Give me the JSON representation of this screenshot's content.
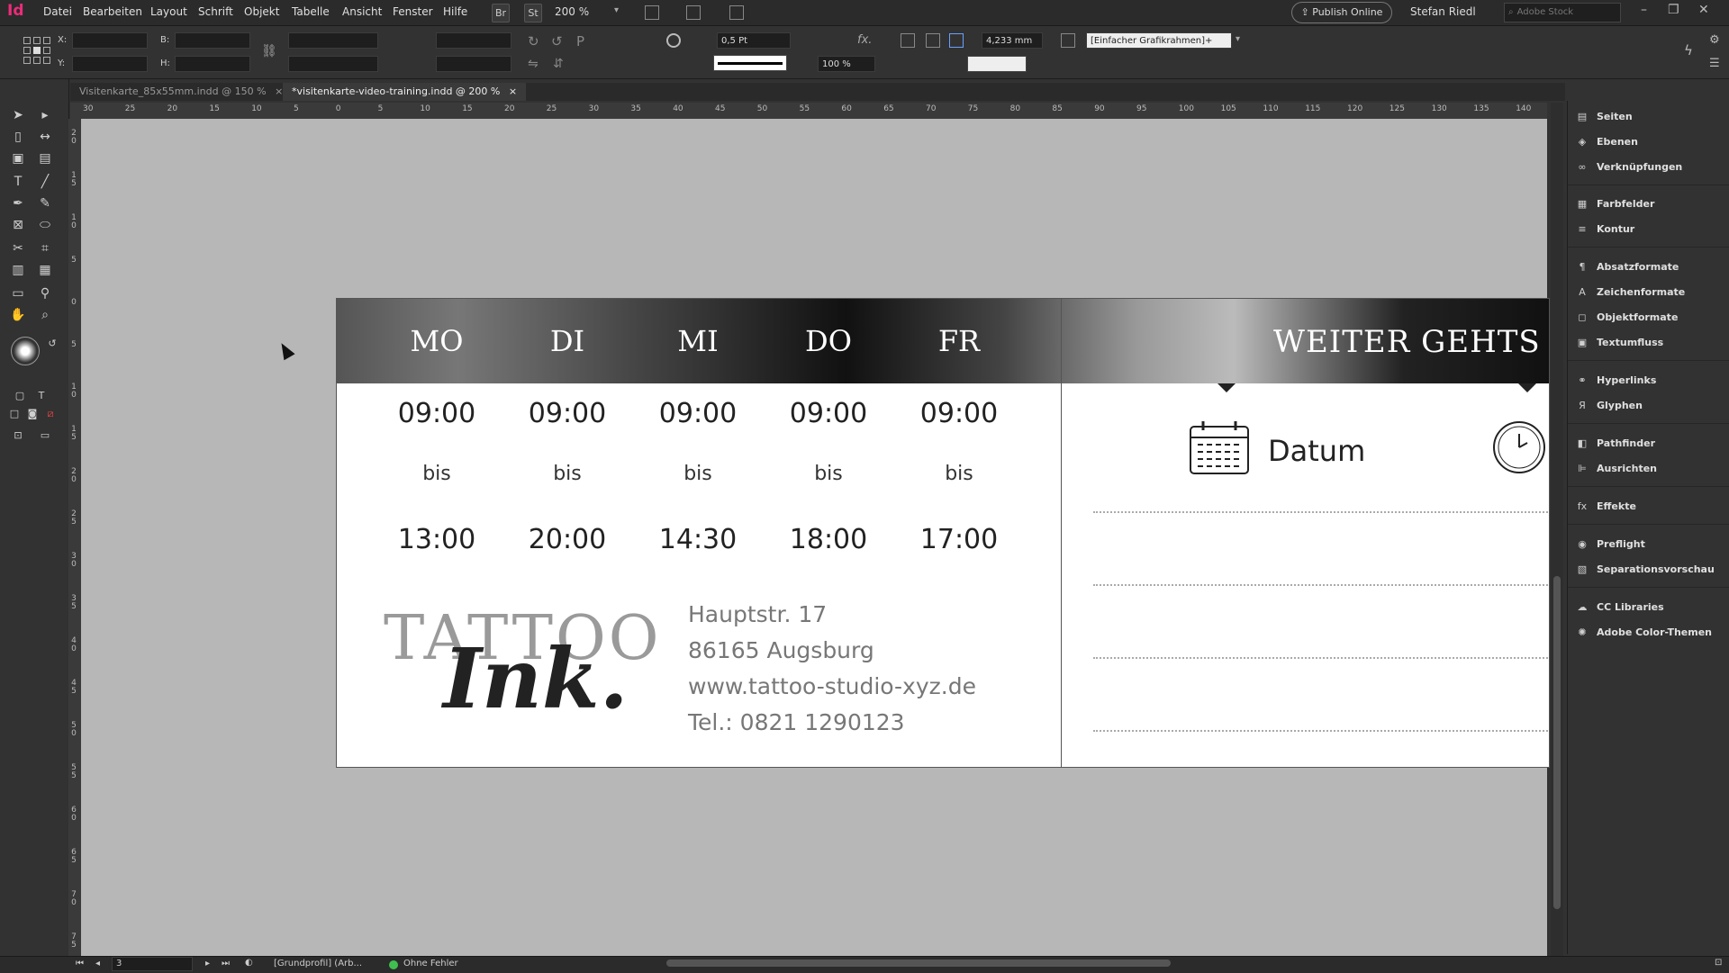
{
  "app": {
    "logo": "Id",
    "menu": [
      "Datei",
      "Bearbeiten",
      "Layout",
      "Schrift",
      "Objekt",
      "Tabelle",
      "Ansicht",
      "Fenster",
      "Hilfe"
    ],
    "bridge": "Br",
    "stock": "St",
    "zoom": "200 %",
    "publish_label": "Publish Online",
    "user": "Stefan Riedl",
    "search_placeholder": "Adobe Stock"
  },
  "control": {
    "x_label": "X:",
    "y_label": "Y:",
    "b_label": "B:",
    "h_label": "H:",
    "stroke_weight": "0,5 Pt",
    "opacity": "100 %",
    "measure": "4,233 mm",
    "frame_style": "[Einfacher Grafikrahmen]+"
  },
  "tabs": [
    {
      "label": "Visitenkarte_85x55mm.indd @ 150 %",
      "active": false
    },
    {
      "label": "*visitenkarte-video-training.indd @ 200 %",
      "active": true
    }
  ],
  "ruler": {
    "h_ticks": [
      "30",
      "25",
      "20",
      "15",
      "10",
      "5",
      "0",
      "5",
      "10",
      "15",
      "20",
      "25",
      "30",
      "35",
      "40",
      "45",
      "50",
      "55",
      "60",
      "65",
      "70",
      "75",
      "80",
      "85",
      "90",
      "95",
      "100",
      "105",
      "110",
      "115",
      "120",
      "125",
      "130",
      "135",
      "140"
    ],
    "v_ticks": [
      "2 0",
      "1 5",
      "1 0",
      "5",
      "0",
      "5",
      "1 0",
      "1 5",
      "2 0",
      "2 5",
      "3 0",
      "3 5",
      "4 0",
      "4 5",
      "5 0",
      "5 5",
      "6 0",
      "6 5",
      "7 0",
      "7 5"
    ]
  },
  "card": {
    "days": [
      "MO",
      "DI",
      "MI",
      "DO",
      "FR"
    ],
    "start_times": [
      "09:00",
      "09:00",
      "09:00",
      "09:00",
      "09:00"
    ],
    "bis": "bis",
    "end_times": [
      "13:00",
      "20:00",
      "14:30",
      "18:00",
      "17:00"
    ],
    "logo_top": "TATTOO",
    "logo_script": "Ink.",
    "address": [
      "Hauptstr. 17",
      "86165 Augsburg",
      "www.tattoo-studio-xyz.de",
      "Tel.: 0821 1290123"
    ],
    "right_header": "WEITER GEHTS AM",
    "datum_label": "Datum"
  },
  "panels": [
    {
      "label": "Seiten",
      "icon": "pages-icon",
      "glyph": "▤"
    },
    {
      "label": "Ebenen",
      "icon": "layers-icon",
      "glyph": "◈"
    },
    {
      "label": "Verknüpfungen",
      "icon": "links-icon",
      "glyph": "∞"
    },
    {
      "label": "Farbfelder",
      "icon": "swatches-icon",
      "glyph": "▦"
    },
    {
      "label": "Kontur",
      "icon": "stroke-icon",
      "glyph": "≡"
    },
    {
      "label": "Absatzformate",
      "icon": "paragraph-styles-icon",
      "glyph": "¶"
    },
    {
      "label": "Zeichenformate",
      "icon": "character-styles-icon",
      "glyph": "A"
    },
    {
      "label": "Objektformate",
      "icon": "object-styles-icon",
      "glyph": "◻"
    },
    {
      "label": "Textumfluss",
      "icon": "text-wrap-icon",
      "glyph": "▣"
    },
    {
      "label": "Hyperlinks",
      "icon": "hyperlinks-icon",
      "glyph": "⚭"
    },
    {
      "label": "Glyphen",
      "icon": "glyphs-icon",
      "glyph": "Я"
    },
    {
      "label": "Pathfinder",
      "icon": "pathfinder-icon",
      "glyph": "◧"
    },
    {
      "label": "Ausrichten",
      "icon": "align-icon",
      "glyph": "⊫"
    },
    {
      "label": "Effekte",
      "icon": "effects-icon",
      "glyph": "fx"
    },
    {
      "label": "Preflight",
      "icon": "preflight-icon",
      "glyph": "◉"
    },
    {
      "label": "Separationsvorschau",
      "icon": "separations-icon",
      "glyph": "▧"
    },
    {
      "label": "CC Libraries",
      "icon": "cc-libraries-icon",
      "glyph": "☁"
    },
    {
      "label": "Adobe Color-Themen",
      "icon": "color-themes-icon",
      "glyph": "✺"
    }
  ],
  "status": {
    "page": "3",
    "profile": "[Grundprofil] (Arb...",
    "preflight": "Ohne Fehler"
  }
}
